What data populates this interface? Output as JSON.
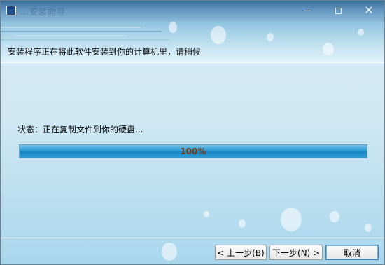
{
  "window": {
    "title": "…安装向导",
    "controls": {
      "minimize_icon": "minimize-icon",
      "maximize_icon": "maximize-icon",
      "close_icon": "close-icon",
      "close_glyph": "✕"
    }
  },
  "header": {
    "text": "安装程序正在将此软件安装到你的计算机里，请稍候"
  },
  "main": {
    "status_label": "状态：正在复制文件到你的硬盘...",
    "progress": {
      "value": 100,
      "text": "100%"
    }
  },
  "footer": {
    "buttons": {
      "back": "< 上一步(B)",
      "next": "下一步(N) >",
      "cancel": "取消"
    }
  },
  "colors": {
    "progress_fill": "#2b9ad5",
    "progress_text": "#7a3b12",
    "accent_border": "#3c7fb1"
  }
}
